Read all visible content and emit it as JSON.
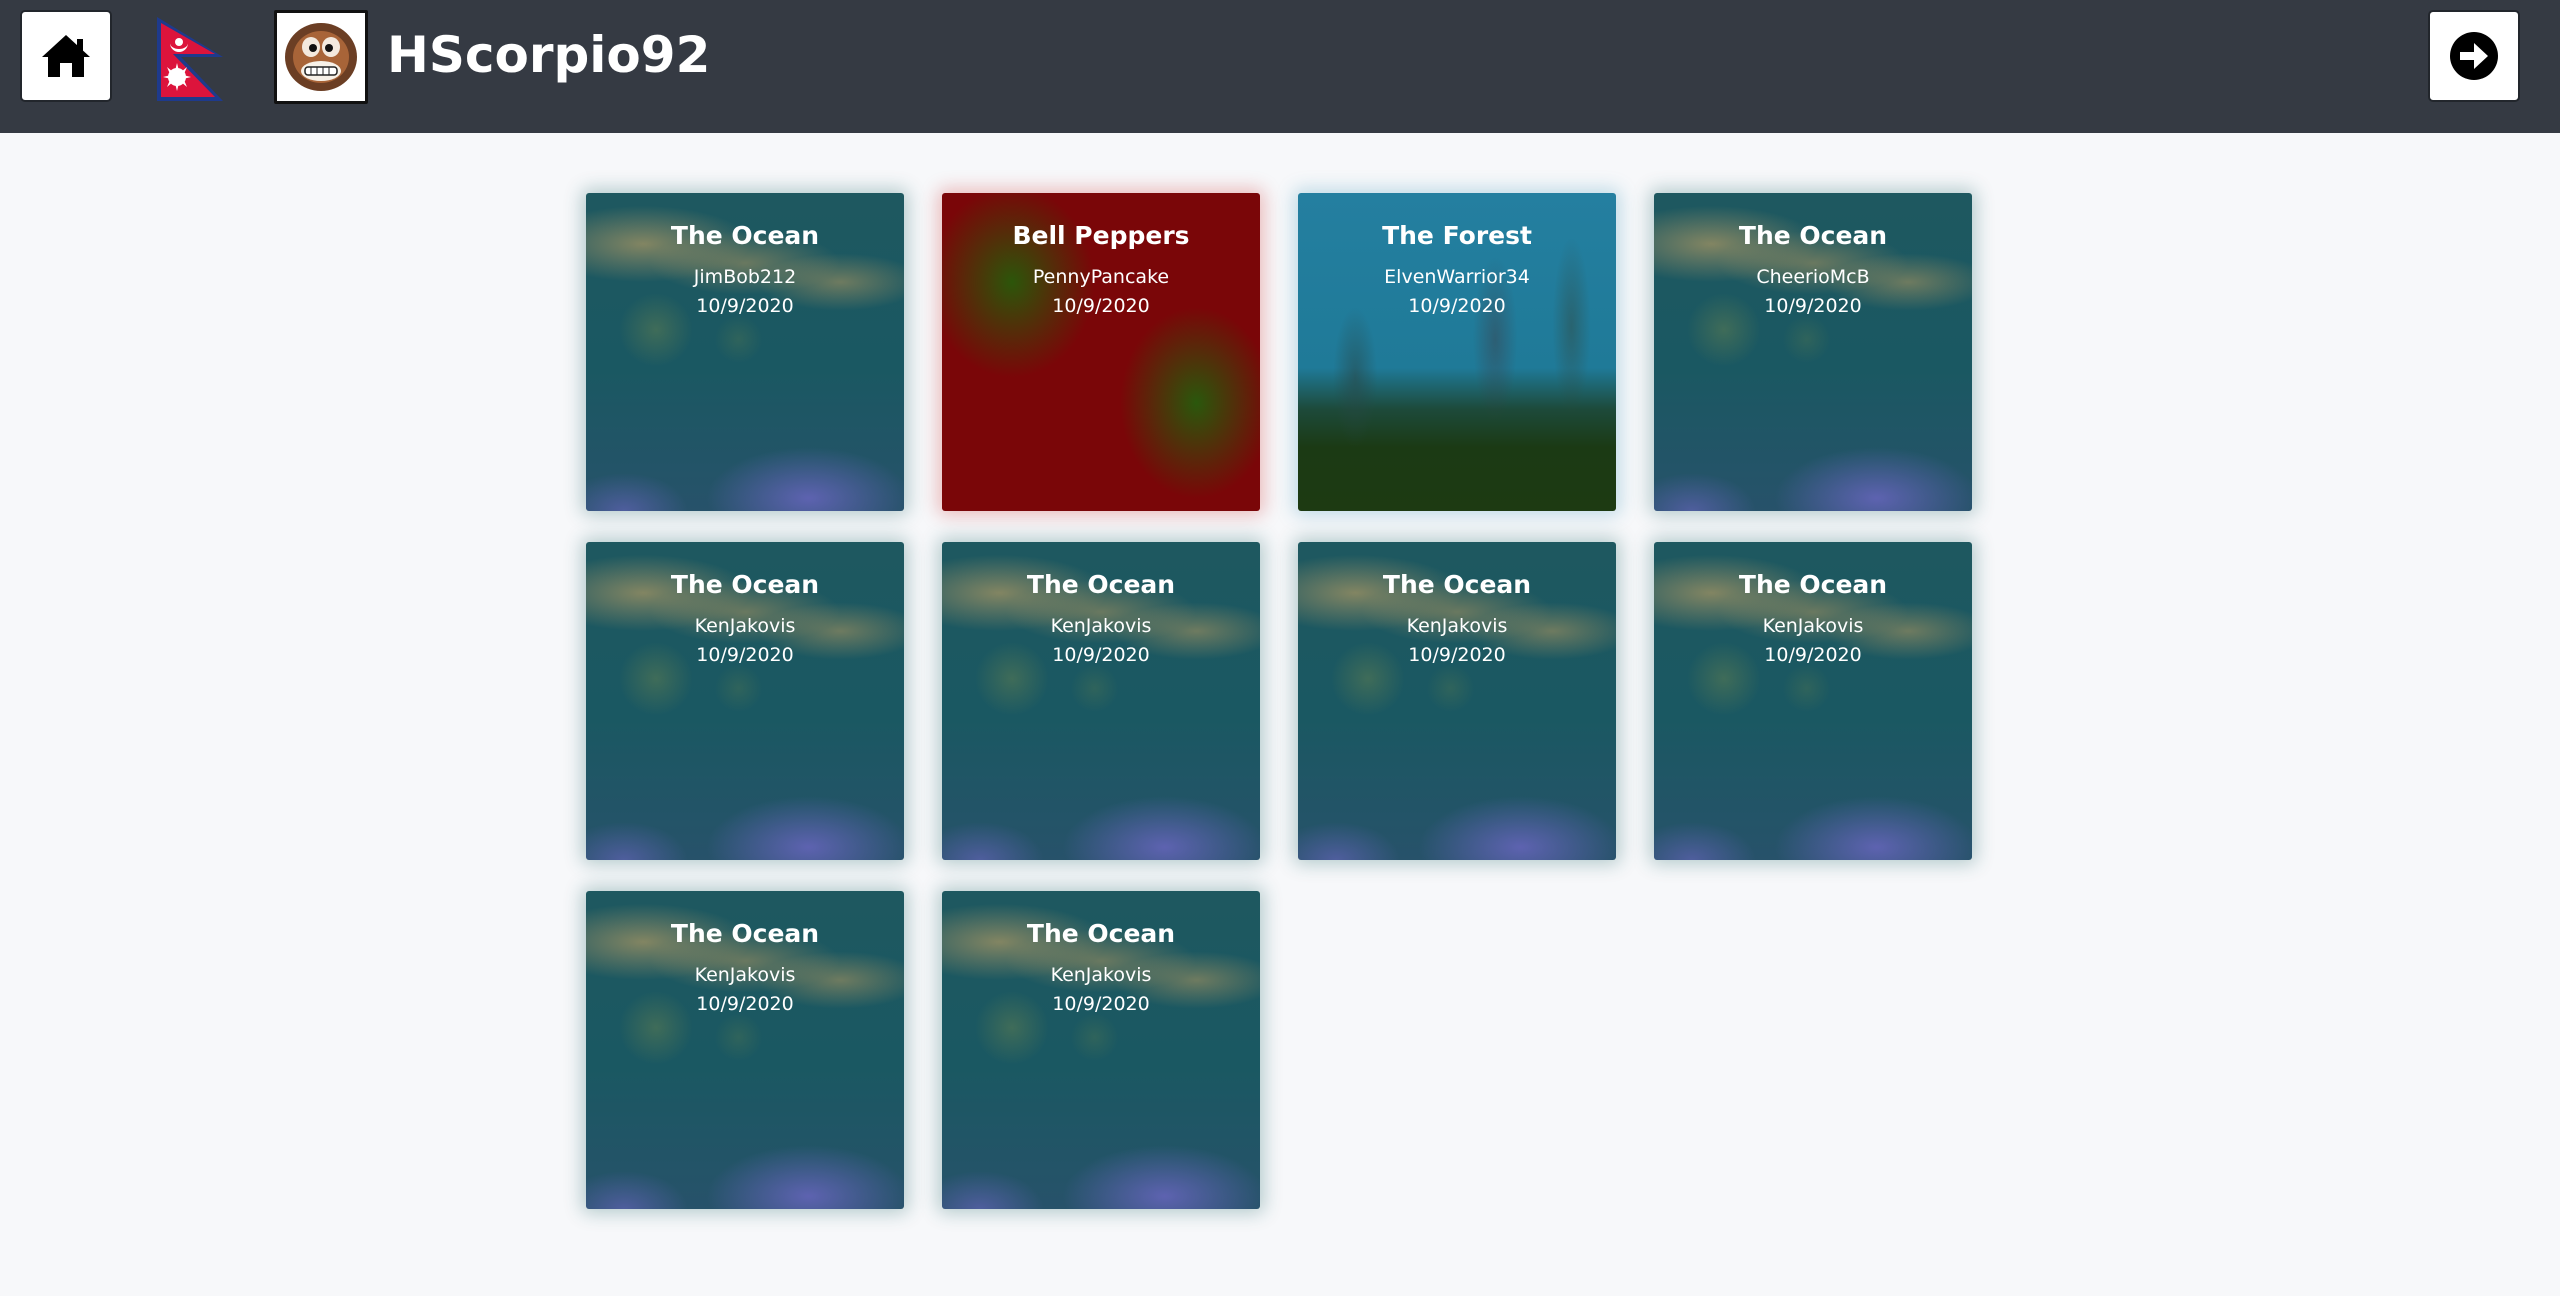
{
  "header": {
    "username": "HScorpio92",
    "home_icon": "home-icon",
    "flag_icon": "nepal-flag-icon",
    "avatar_icon": "monkey-avatar-icon",
    "logout_icon": "arrow-right-circle-icon",
    "background_color": "#353a43"
  },
  "gallery": {
    "cards": [
      {
        "title": "The Ocean",
        "author": "JimBob212",
        "date": "10/9/2020",
        "art": "ocean"
      },
      {
        "title": "Bell Peppers",
        "author": "PennyPancake",
        "date": "10/9/2020",
        "art": "peppers"
      },
      {
        "title": "The Forest",
        "author": "ElvenWarrior34",
        "date": "10/9/2020",
        "art": "forest"
      },
      {
        "title": "The Ocean",
        "author": "CheerioMcB",
        "date": "10/9/2020",
        "art": "ocean"
      },
      {
        "title": "The Ocean",
        "author": "KenJakovis",
        "date": "10/9/2020",
        "art": "ocean"
      },
      {
        "title": "The Ocean",
        "author": "KenJakovis",
        "date": "10/9/2020",
        "art": "ocean"
      },
      {
        "title": "The Ocean",
        "author": "KenJakovis",
        "date": "10/9/2020",
        "art": "ocean"
      },
      {
        "title": "The Ocean",
        "author": "KenJakovis",
        "date": "10/9/2020",
        "art": "ocean"
      },
      {
        "title": "The Ocean",
        "author": "KenJakovis",
        "date": "10/9/2020",
        "art": "ocean"
      },
      {
        "title": "The Ocean",
        "author": "KenJakovis",
        "date": "10/9/2020",
        "art": "ocean"
      }
    ]
  }
}
